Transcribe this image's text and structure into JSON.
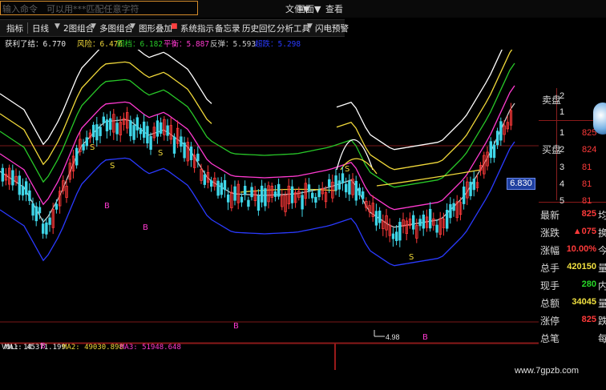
{
  "command_bar": {
    "placeholder": "输入命令　可以用***匹配任意字符"
  },
  "menu": {
    "items": [
      "文件▼",
      "画面▼",
      "查看"
    ]
  },
  "toolbar": {
    "items": [
      "指标",
      "日线",
      "2图组合",
      "多图组合",
      "图形叠加",
      "系统指示",
      "备忘录",
      "历史回忆",
      "分析工具",
      "闪电预警"
    ]
  },
  "indicator_row": {
    "prefix": "获利了结：6.770",
    "risk": "风险：6.476",
    "pullback": "回档：6.182",
    "balance": "平衡：5.887",
    "rebound": "反弹：5.593",
    "extra": "超跌：5.298"
  },
  "volume_row": {
    "vol": "VOL: 14",
    "ma1": "MA1: 45371.199",
    "ma2": "MA2: 49030.898",
    "ma3": "MA3: 51948.648"
  },
  "chart_annotations": {
    "low_price": "4.98",
    "current_price": "6.830"
  },
  "chart_data": {
    "type": "candlestick",
    "colors": {
      "up": "#ff3a3a",
      "down": "#3fd6e8",
      "band_1": "#ffffff",
      "band_2": "#f0d83a",
      "band_3": "#28c828",
      "band_4": "#ff3ad0",
      "band_5": "#c8c8c8",
      "band_6": "#2a3aff"
    },
    "markers": [
      "S",
      "S",
      "S",
      "S",
      "S",
      "B",
      "B",
      "B",
      "B",
      "B"
    ]
  },
  "order_panel": {
    "sell_label": "卖盘",
    "buy_label": "买盘",
    "sell_levels": [
      "2",
      "1"
    ],
    "buy_levels": [
      "1",
      "2",
      "3",
      "4",
      "5"
    ],
    "buy_prices": [
      "825",
      "824",
      "81",
      "81",
      "81"
    ]
  },
  "quote_panel": {
    "rows": [
      {
        "label": "最新",
        "value": "825",
        "extra": "均"
      },
      {
        "label": "涨跌",
        "value": "▲075",
        "extra": "换"
      },
      {
        "label": "涨幅",
        "value": "10.00%",
        "extra": "今"
      },
      {
        "label": "总手",
        "value": "420150",
        "extra": "量"
      },
      {
        "label": "现手",
        "value": "280",
        "extra": "内"
      },
      {
        "label": "总额",
        "value": "34045",
        "extra": "量"
      },
      {
        "label": "涨停",
        "value": "825",
        "extra": "跌"
      },
      {
        "label": "总笔",
        "value": "",
        "extra": "每"
      }
    ]
  },
  "watermark": "www.7gpzb.com"
}
